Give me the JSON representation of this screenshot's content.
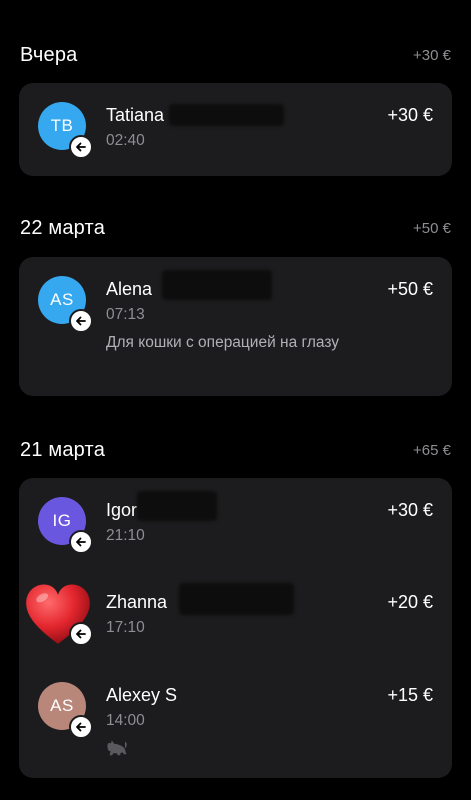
{
  "sections": [
    {
      "title": "Вчера",
      "total": "+30 €",
      "transactions": [
        {
          "initials": "TB",
          "avatar_color": "#35a8ef",
          "name": "Tatiana",
          "time": "02:40",
          "amount": "+30 €",
          "direction": "incoming",
          "badge_icon": "arrow-left-icon"
        }
      ]
    },
    {
      "title": "22 марта",
      "total": "+50 €",
      "transactions": [
        {
          "initials": "AS",
          "avatar_color": "#35a8ef",
          "name": "Alena",
          "time": "07:13",
          "amount": "+50 €",
          "note": "Для кошки с операцией на глазу",
          "direction": "incoming",
          "badge_icon": "arrow-left-icon"
        }
      ]
    },
    {
      "title": "21 марта",
      "total": "+65 €",
      "transactions": [
        {
          "initials": "IG",
          "avatar_color": "#6a57e0",
          "name": "Igor",
          "time": "21:10",
          "amount": "+30 €",
          "direction": "incoming",
          "badge_icon": "arrow-left-icon"
        },
        {
          "initials": "",
          "avatar_icon": "heart-icon",
          "avatar_color": "#e3262e",
          "name": "Zhanna",
          "time": "17:10",
          "amount": "+20 €",
          "direction": "incoming",
          "badge_icon": "arrow-left-icon"
        },
        {
          "initials": "AS",
          "avatar_color": "#b9877a",
          "name": "Alexey S",
          "time": "14:00",
          "amount": "+15 €",
          "note_icon": "cat-icon",
          "direction": "incoming",
          "badge_icon": "arrow-left-icon"
        }
      ]
    }
  ]
}
